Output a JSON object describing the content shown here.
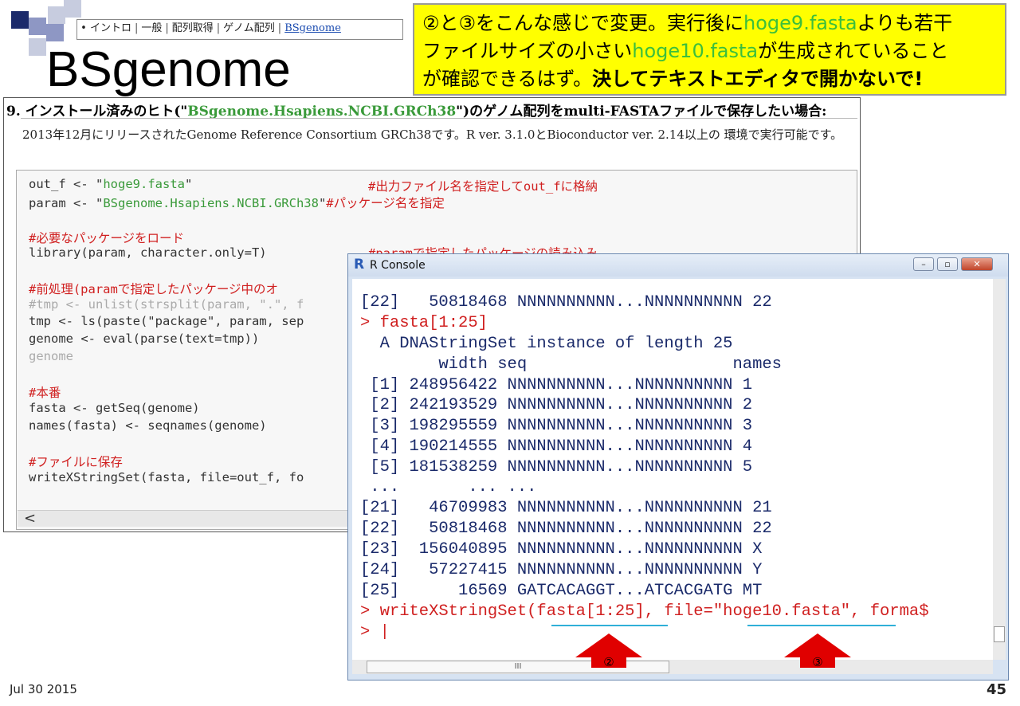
{
  "breadcrumb": {
    "bullet": "•",
    "items": [
      "イントロ",
      "一般",
      "配列取得",
      "ゲノム配列"
    ],
    "active": "BSgenome"
  },
  "slide": {
    "title": "BSgenome",
    "date": "Jul 30 2015",
    "page_number": "45"
  },
  "callout": {
    "part1": "②と③をこんな感じで変更。実行後に",
    "file1": "hoge9.fasta",
    "part2": "よりも若干",
    "part3": "ファイルサイズの小さい",
    "file2": "hoge10.fasta",
    "part4": "が生成されていること",
    "part5": "が確認できるはず。",
    "bold": "決してテキストエディタで開かないで!"
  },
  "web": {
    "heading_pre": "9. インストール済みのヒト(\"",
    "heading_pkg": "BSgenome.Hsapiens.NCBI.GRCh38",
    "heading_post": "\")のゲノム配列をmulti-FASTAファイルで保存したい場合:",
    "desc": "2013年12月にリリースされたGenome Reference Consortium GRCh38です。R ver. 3.1.0とBioconductor ver. 2.14以上の 環境で実行可能です。",
    "code": {
      "l1a": "out_f <- \"",
      "l1s": "hoge9.fasta",
      "l1b": "\"",
      "l1c": "#出力ファイル名を指定してout_fに格納",
      "l2a": "param <- \"",
      "l2s": "BSgenome.Hsapiens.NCBI.GRCh38",
      "l2b": "\"",
      "l2c": "#パッケージ名を指定",
      "l3": "#必要なパッケージをロード",
      "l4": "library(param, character.only=T)",
      "l4c": "#paramで指定したパッケージの読み込み",
      "l5": "#前処理(paramで指定したパッケージ中のオ",
      "l6": "#tmp <- unlist(strsplit(param, \".\", f",
      "l7": "tmp <- ls(paste(\"package\", param, sep",
      "l8": "genome <- eval(parse(text=tmp))",
      "l9": "genome",
      "l10": "#本番",
      "l11": "fasta <- getSeq(genome)",
      "l12": "names(fasta) <- seqnames(genome)",
      "l13": "#ファイルに保存",
      "l14": "writeXStringSet(fasta, file=out_f, fo"
    },
    "scroll_left": "<"
  },
  "console": {
    "logo": "R",
    "title": "R Console",
    "btn_min": "–",
    "btn_max": "▫",
    "btn_close": "✕",
    "lines": [
      "[22]   50818468 NNNNNNNNNN...NNNNNNNNNN 22",
      "> fasta[1:25]",
      "  A DNAStringSet instance of length 25",
      "        width seq                     names",
      " [1] 248956422 NNNNNNNNNN...NNNNNNNNNN 1",
      " [2] 242193529 NNNNNNNNNN...NNNNNNNNNN 2",
      " [3] 198295559 NNNNNNNNNN...NNNNNNNNNN 3",
      " [4] 190214555 NNNNNNNNNN...NNNNNNNNNN 4",
      " [5] 181538259 NNNNNNNNNN...NNNNNNNNNN 5",
      " ...       ... ...",
      "[21]   46709983 NNNNNNNNNN...NNNNNNNNNN 21",
      "[22]   50818468 NNNNNNNNNN...NNNNNNNNNN 22",
      "[23]  156040895 NNNNNNNNNN...NNNNNNNNNN X",
      "[24]   57227415 NNNNNNNNNN...NNNNNNNNNN Y",
      "[25]      16569 GATCACAGGT...ATCACGATG MT",
      "> writeXStringSet(fasta[1:25], file=\"hoge10.fasta\", forma$",
      "> |"
    ],
    "hscroll_grip": "III",
    "marker2": "②",
    "marker3": "③"
  },
  "colors": {
    "callout_bg": "#ffff00",
    "accent_green": "#3cbf3c",
    "code_red": "#d02020",
    "arrow_red": "#e00000",
    "underline_cyan": "#30b0d8"
  }
}
